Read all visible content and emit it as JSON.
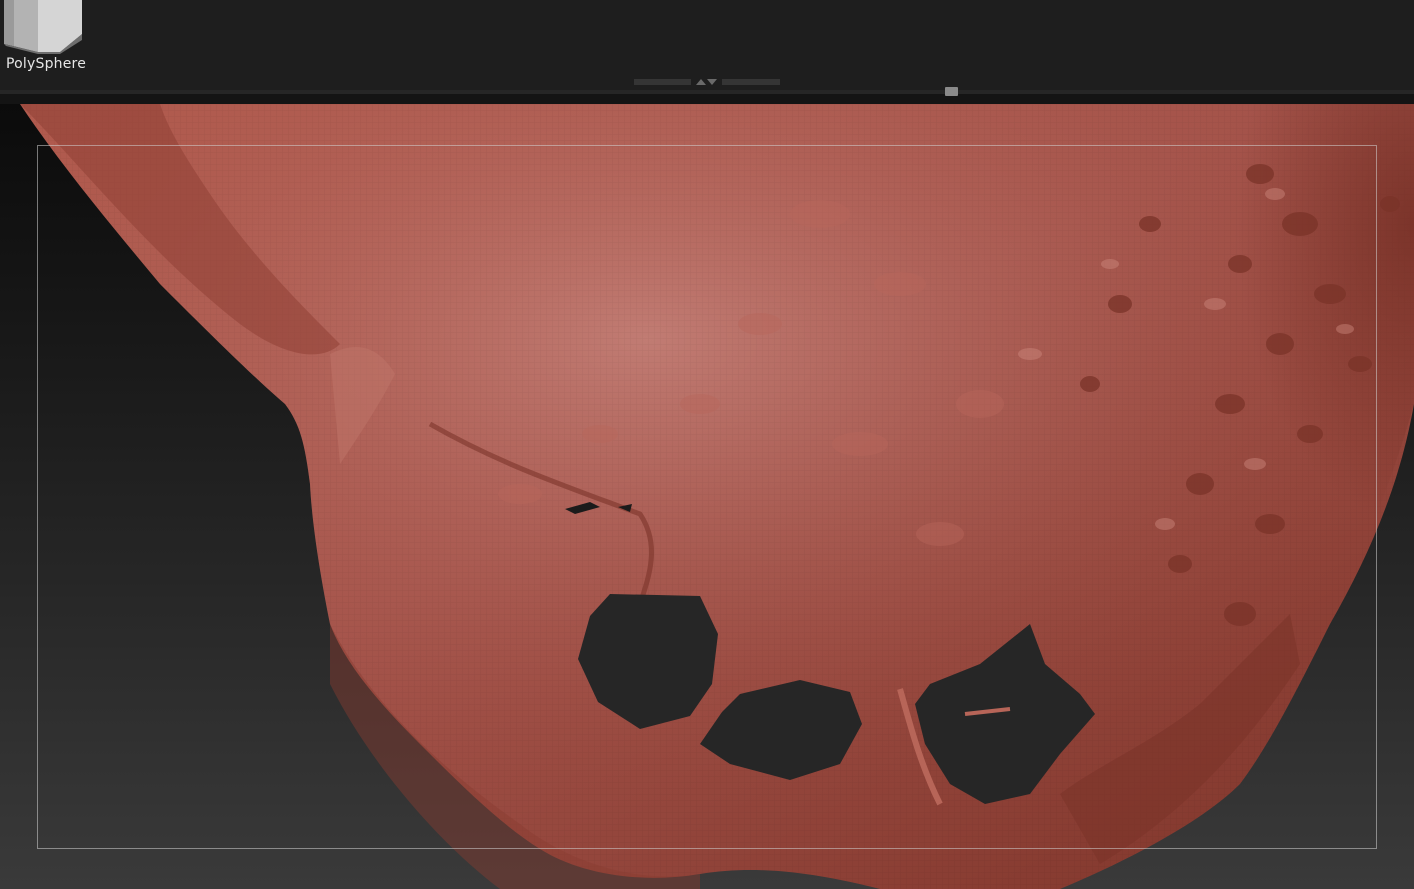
{
  "shelf": {
    "active_tool": {
      "label": "PolySphere",
      "icon": "polysphere-cube-icon"
    },
    "toggle_icon": "expand-collapse-arrows-icon",
    "scroll_grip_icon": "scroll-grip-icon"
  },
  "viewport": {
    "mesh_color": "#a24a3e",
    "background_top": "#0b0b0b",
    "background_bottom": "#3a3a3a",
    "frame_color": "#d2d2d2"
  }
}
